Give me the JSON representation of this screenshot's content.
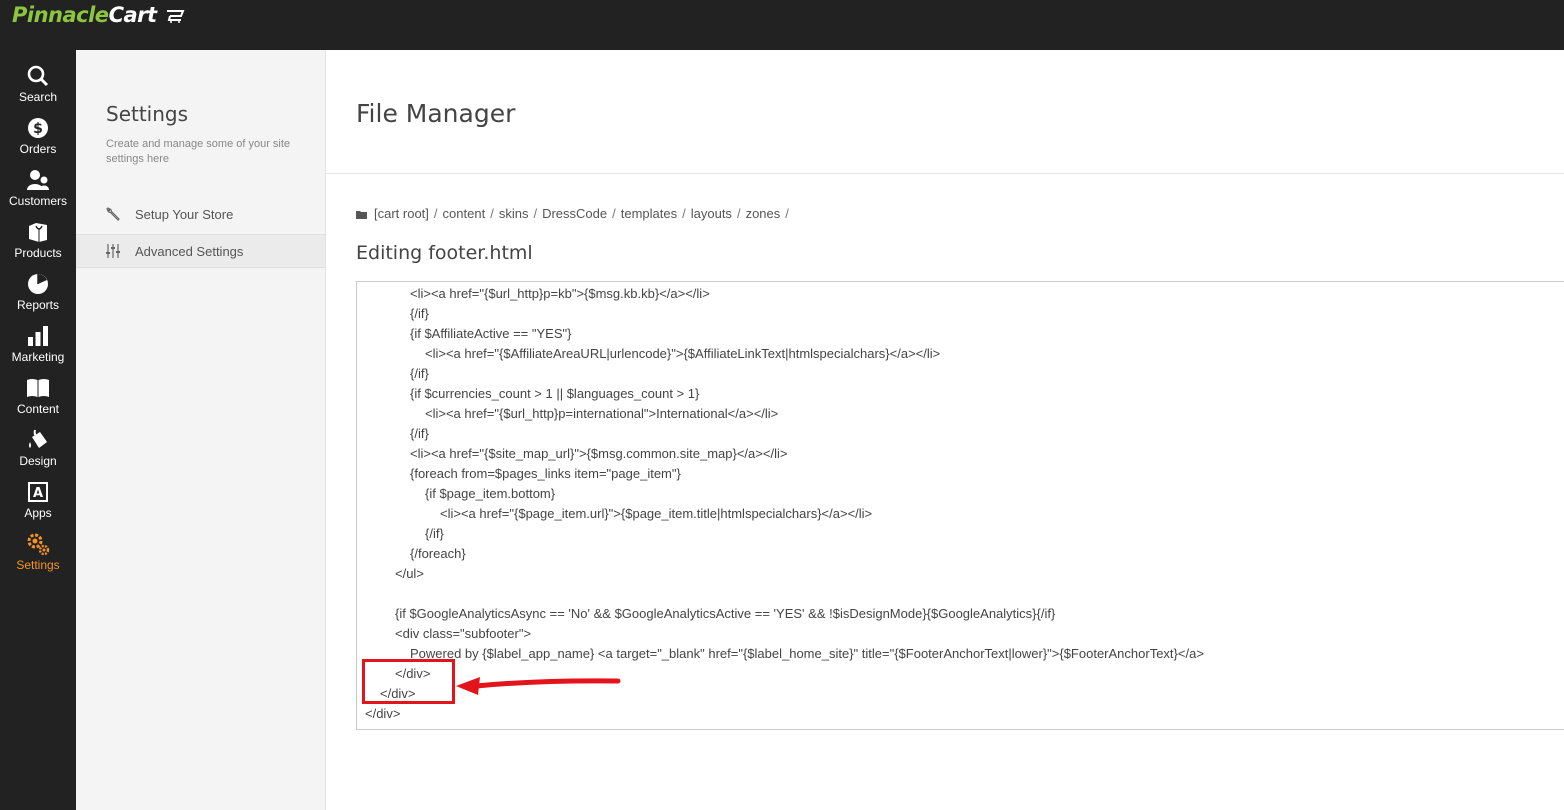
{
  "brand": {
    "name_part1": "Pinnacle",
    "name_part2": "Cart",
    "accent": "#8cc63f",
    "active_color": "#f7941d",
    "highlight_color": "#e3141b"
  },
  "nav": {
    "items": [
      {
        "label": "Search",
        "icon": "search-icon"
      },
      {
        "label": "Orders",
        "icon": "dollar-icon"
      },
      {
        "label": "Customers",
        "icon": "users-icon"
      },
      {
        "label": "Products",
        "icon": "box-icon"
      },
      {
        "label": "Reports",
        "icon": "pie-chart-icon"
      },
      {
        "label": "Marketing",
        "icon": "bar-chart-icon"
      },
      {
        "label": "Content",
        "icon": "book-icon"
      },
      {
        "label": "Design",
        "icon": "paint-bucket-icon"
      },
      {
        "label": "Apps",
        "icon": "apps-icon"
      },
      {
        "label": "Settings",
        "icon": "gears-icon",
        "active": true
      }
    ]
  },
  "subnav": {
    "title": "Settings",
    "description": "Create and manage some of your site settings here",
    "items": [
      {
        "label": "Setup Your Store",
        "icon": "wrench-icon"
      },
      {
        "label": "Advanced Settings",
        "icon": "sliders-icon",
        "selected": true
      }
    ]
  },
  "main": {
    "title": "File Manager",
    "breadcrumb": [
      "[cart root]",
      "content",
      "skins",
      "DressCode",
      "templates",
      "layouts",
      "zones"
    ],
    "editing_title": "Editing footer.html",
    "code_lines": [
      "<li><a href=\"{$url_http}p=kb\">{$msg.kb.kb}</a></li>",
      "{/if}",
      "{if $AffiliateActive == \"YES\"}",
      "<li><a href=\"{$AffiliateAreaURL|urlencode}\">{$AffiliateLinkText|htmlspecialchars}</a></li>",
      "{/if}",
      "{if $currencies_count > 1 || $languages_count > 1}",
      "<li><a href=\"{$url_http}p=international\">International</a></li>",
      "{/if}",
      "<li><a href=\"{$site_map_url}\">{$msg.common.site_map}</a></li>",
      "{foreach from=$pages_links item=\"page_item\"}",
      "{if $page_item.bottom}",
      "<li><a href=\"{$page_item.url}\">{$page_item.title|htmlspecialchars}</a></li>",
      "{/if}",
      "{/foreach}",
      "</ul>",
      "",
      "{if $GoogleAnalyticsAsync == 'No' && $GoogleAnalyticsActive == 'YES' && !$isDesignMode}{$GoogleAnalytics}{/if}",
      "<div class=\"subfooter\">",
      "Powered by {$label_app_name} <a target=\"_blank\" href=\"{$label_home_site}\" title=\"{$FooterAnchorText|lower}\">{$FooterAnchorText}</a>",
      "</div>",
      "</div>",
      "</div>"
    ]
  }
}
